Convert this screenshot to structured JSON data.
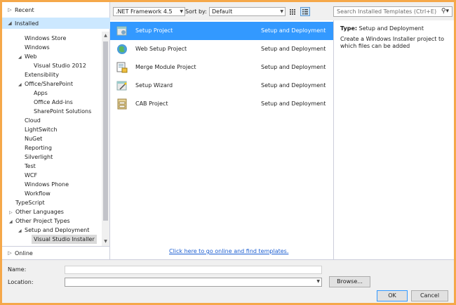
{
  "sidebar": {
    "recent_label": "Recent",
    "installed_label": "Installed",
    "online_label": "Online",
    "tree": [
      {
        "label": "Windows Store",
        "arrow": ""
      },
      {
        "label": "Windows",
        "arrow": ""
      },
      {
        "label": "Web",
        "arrow": "◢"
      },
      {
        "label": "Visual Studio 2012",
        "arrow": ""
      },
      {
        "label": "Extensibility",
        "arrow": ""
      },
      {
        "label": "Office/SharePoint",
        "arrow": "◢"
      },
      {
        "label": "Apps",
        "arrow": ""
      },
      {
        "label": "Office Add-ins",
        "arrow": ""
      },
      {
        "label": "SharePoint Solutions",
        "arrow": ""
      },
      {
        "label": "Cloud",
        "arrow": ""
      },
      {
        "label": "LightSwitch",
        "arrow": ""
      },
      {
        "label": "NuGet",
        "arrow": ""
      },
      {
        "label": "Reporting",
        "arrow": ""
      },
      {
        "label": "Silverlight",
        "arrow": ""
      },
      {
        "label": "Test",
        "arrow": ""
      },
      {
        "label": "WCF",
        "arrow": ""
      },
      {
        "label": "Windows Phone",
        "arrow": ""
      },
      {
        "label": "Workflow",
        "arrow": ""
      },
      {
        "label": "TypeScript",
        "arrow": ""
      },
      {
        "label": "Other Languages",
        "arrow": "▷"
      },
      {
        "label": "Other Project Types",
        "arrow": "◢"
      },
      {
        "label": "Setup and Deployment",
        "arrow": "◢"
      },
      {
        "label": "Visual Studio Installer",
        "arrow": ""
      }
    ]
  },
  "toolbar": {
    "framework": ".NET Framework 4.5",
    "sort_label": "Sort by:",
    "sort_value": "Default",
    "search_placeholder": "Search Installed Templates (Ctrl+E)"
  },
  "templates": [
    {
      "name": "Setup Project",
      "category": "Setup and Deployment",
      "icon": "setup-project-icon"
    },
    {
      "name": "Web Setup Project",
      "category": "Setup and Deployment",
      "icon": "web-setup-icon"
    },
    {
      "name": "Merge Module Project",
      "category": "Setup and Deployment",
      "icon": "merge-module-icon"
    },
    {
      "name": "Setup Wizard",
      "category": "Setup and Deployment",
      "icon": "setup-wizard-icon"
    },
    {
      "name": "CAB Project",
      "category": "Setup and Deployment",
      "icon": "cab-project-icon"
    }
  ],
  "online_link": "Click here to go online and find templates.",
  "description": {
    "type_label": "Type:",
    "type_value": "Setup and Deployment",
    "text": "Create a Windows Installer project to which files can be added"
  },
  "form": {
    "name_label": "Name:",
    "name_value": "",
    "location_label": "Location:",
    "location_value": "",
    "browse_label": "Browse...",
    "ok_label": "OK",
    "cancel_label": "Cancel"
  },
  "colors": {
    "selection": "#3399ff",
    "frame": "#f5a84a",
    "link": "#1a5dd1"
  }
}
